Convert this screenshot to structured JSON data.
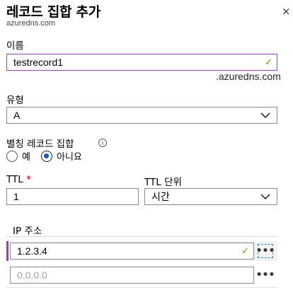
{
  "header": {
    "title": "레코드 집합 추가",
    "subtitle": "azuredns.com",
    "close_label": "×"
  },
  "name_field": {
    "label": "이름",
    "value": "testrecord1",
    "suffix": ".azuredns.com"
  },
  "type_field": {
    "label": "유형",
    "value": "A"
  },
  "alias": {
    "label": "별칭 레코드 집합",
    "info_symbol": "i",
    "options": [
      "예",
      "아니요"
    ],
    "selected": "아니요"
  },
  "ttl": {
    "label": "TTL",
    "required_mark": "*",
    "value": "1"
  },
  "ttl_unit": {
    "label": "TTL 단위",
    "value": "시간"
  },
  "ip_section": {
    "header": "IP 주소",
    "rows": [
      {
        "value": "1.2.3.4",
        "more": "•••"
      },
      {
        "placeholder": "0.0.0.0",
        "more": "•••"
      }
    ]
  },
  "colors": {
    "focus_border": "#9a3fb5",
    "check": "#57a300",
    "radio_selected": "#0a5fb7",
    "required": "#c4001a"
  }
}
